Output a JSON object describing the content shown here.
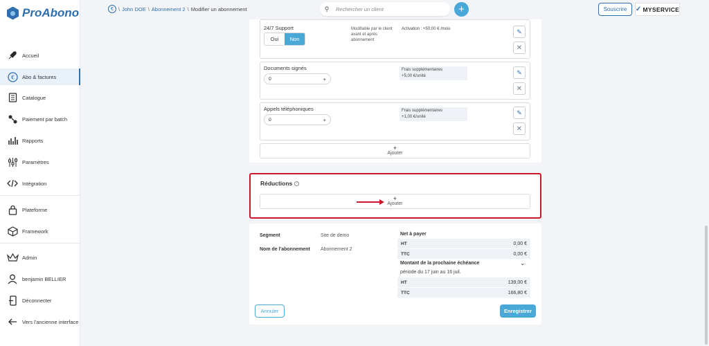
{
  "app": {
    "name": "ProAbono"
  },
  "sidebar": {
    "items": [
      {
        "label": "Accueil",
        "icon": "rocket-icon"
      },
      {
        "label": "Abo & factures",
        "icon": "euro-icon",
        "active": true
      },
      {
        "label": "Catalogue",
        "icon": "catalog-icon"
      },
      {
        "label": "Paiement par batch",
        "icon": "batch-icon"
      },
      {
        "label": "Rapports",
        "icon": "chart-icon"
      },
      {
        "label": "Paramètres",
        "icon": "sliders-icon"
      },
      {
        "label": "Intégration",
        "icon": "code-icon"
      },
      {
        "label": "Plateforme",
        "icon": "lock-icon"
      },
      {
        "label": "Framework",
        "icon": "cube-icon"
      },
      {
        "label": "Admin",
        "icon": "crown-icon"
      },
      {
        "label": "benjamin BELLIER",
        "icon": "user-icon"
      },
      {
        "label": "Déconnecter",
        "icon": "logout-icon"
      },
      {
        "label": "Vers l'ancienne interface",
        "icon": "back-arrow-icon"
      }
    ]
  },
  "breadcrumb": {
    "customer": "John DOE",
    "subscription": "Abonnement 2",
    "current": "Modifier un abonnement"
  },
  "search": {
    "placeholder": "Rechercher un client"
  },
  "header": {
    "subscribe_label": "Souscrire",
    "brand": "MYSERVICE"
  },
  "options": {
    "support": {
      "label": "24/7 Support",
      "yes": "Oui",
      "no": "Non",
      "note": "Modifiable par le client avant et après abonnement",
      "price": "Activation : +50,00 € /mois"
    },
    "documents": {
      "label": "Documents signés",
      "value": "0",
      "price_line1": "Frais supplémentaires",
      "price_line2": "+5,00 €/unité"
    },
    "calls": {
      "label": "Appels téléphoniques",
      "value": "0",
      "price_line1": "Frais supplémentaires",
      "price_line2": "+1,00 €/unité"
    },
    "add_label": "Ajouter"
  },
  "reductions": {
    "title": "Réductions",
    "add_label": "Ajouter"
  },
  "summary": {
    "segment_label": "Segment",
    "segment_value": "Site de demo",
    "name_label": "Nom de l'abonnement",
    "name_value": "Abonnement 2",
    "net_title": "Net à payer",
    "ht_label": "HT",
    "ht_value": "0,00 €",
    "ttc_label": "TTC",
    "ttc_value": "0,00 €",
    "next_title": "Montant de la prochaine échéance",
    "period": "période du 17 juin au 16 juil.",
    "next_ht_value": "139,00 €",
    "next_ttc_value": "166,80 €"
  },
  "actions": {
    "cancel": "Annuler",
    "save": "Enregistrer"
  },
  "colors": {
    "brand": "#2f6fb0",
    "accent": "#4aa8d8",
    "highlight": "#c9182b"
  }
}
